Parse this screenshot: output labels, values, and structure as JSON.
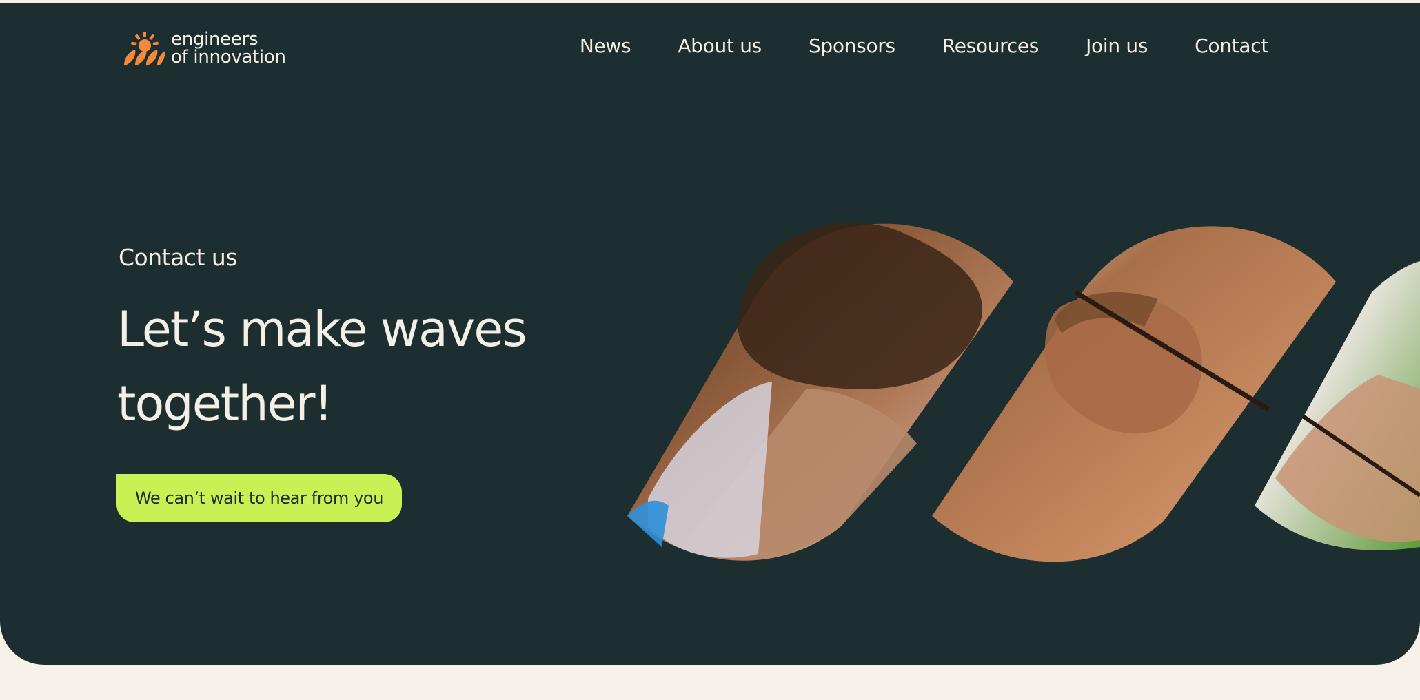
{
  "brand": {
    "line1": "engineers",
    "line2": "of innovation",
    "logo_icon": "sun-over-waves-icon",
    "logo_color": "#f28a3a"
  },
  "nav": {
    "items": [
      "News",
      "About us",
      "Sponsors",
      "Resources",
      "Join us",
      "Contact"
    ]
  },
  "hero": {
    "eyebrow": "Contact us",
    "headline_line1": "Let’s make waves",
    "headline_line2": "together!",
    "cta_label": "We can’t wait to hear from you"
  },
  "colors": {
    "background": "#1c2e2f",
    "page": "#f6f2ea",
    "text": "#f3efe6",
    "accent": "#c8f253"
  }
}
